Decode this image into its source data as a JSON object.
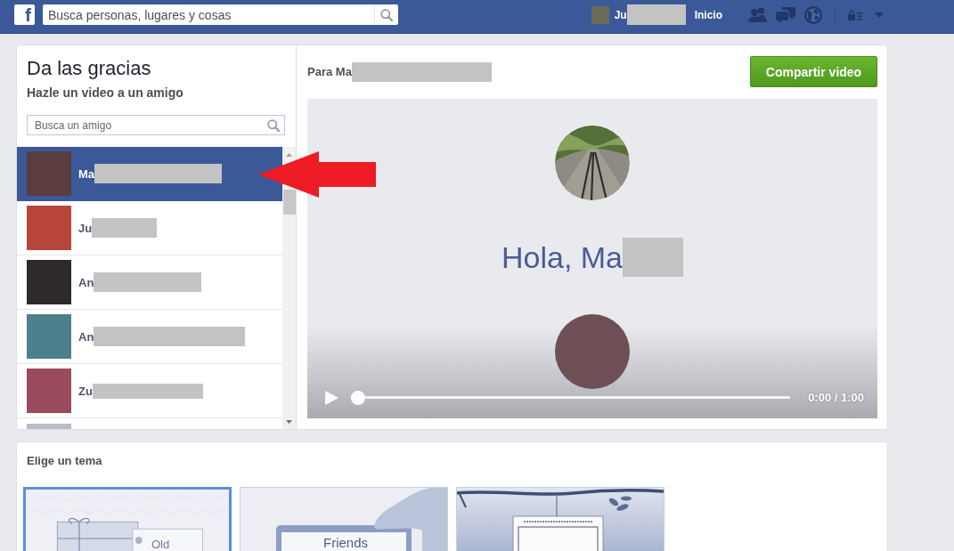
{
  "topbar": {
    "logo": "f",
    "search": {
      "placeholder": "Busca personas, lugares y cosas"
    },
    "user": {
      "name": "Ju",
      "redacted": true
    },
    "nav": [
      {
        "label": "Inicio"
      }
    ],
    "icons": [
      {
        "kind": "friends"
      },
      {
        "kind": "messages"
      },
      {
        "kind": "notifications"
      },
      {
        "kind": "privacy"
      },
      {
        "kind": "menu"
      }
    ]
  },
  "friend_picker": {
    "title": "Da las gracias",
    "subtitle": "Hazle un video a un amigo",
    "search": {
      "placeholder": "Busca un amigo"
    },
    "friends": [
      {
        "name": "Ma",
        "redacted": true,
        "selected": true
      },
      {
        "name": "Ju",
        "redacted": true,
        "selected": false
      },
      {
        "name": "An",
        "redacted": true,
        "selected": false
      },
      {
        "name": "An",
        "redacted": true,
        "selected": false
      },
      {
        "name": "Zu",
        "redacted": true,
        "selected": false
      },
      {
        "selected": false
      }
    ]
  },
  "annotations": [
    {
      "kind": "arrow"
    }
  ],
  "video_panel": {
    "recipient": {
      "label": "Para Ma",
      "redacted": true
    },
    "share_button": "Compartir video",
    "greeting": {
      "text": "Hola, Ma",
      "redacted": true
    },
    "progress": {
      "level": 0
    },
    "time": "0:00 / 1:00"
  },
  "themes": {
    "title": "Elige un tema",
    "items": [
      {
        "kind": "package",
        "label": "Old",
        "selected": true
      },
      {
        "kind": "card",
        "label": "Friends",
        "selected": false
      },
      {
        "kind": "sign",
        "selected": false
      }
    ]
  }
}
